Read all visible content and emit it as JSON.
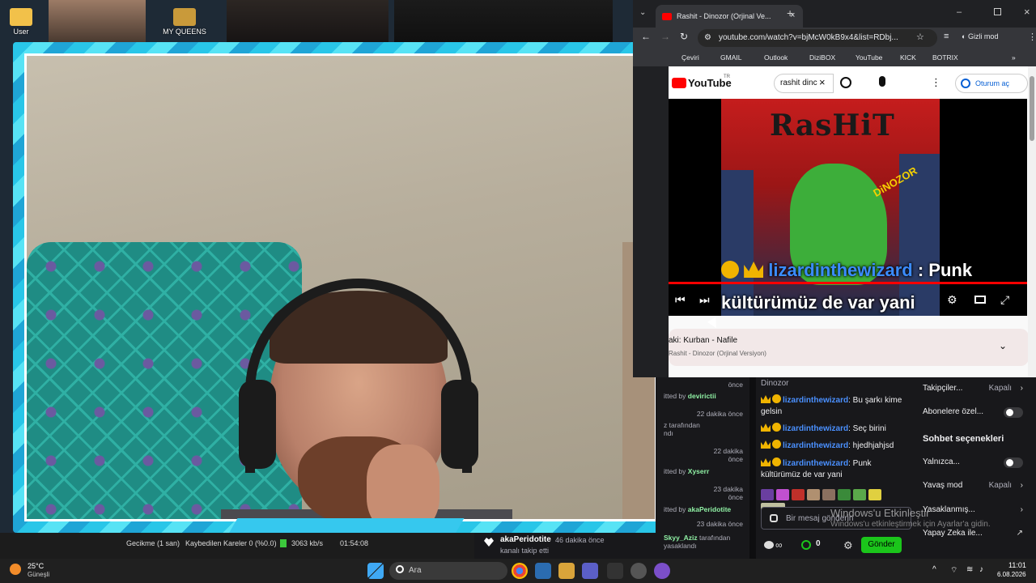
{
  "desktop": {
    "icons": [
      {
        "label": "User",
        "icon": "folder-icon"
      },
      {
        "label": "MY QUEENS",
        "icon": "folder-icon"
      }
    ]
  },
  "obs": {
    "delay": "Gecikme (1 san)",
    "dropped": "Kaybedilen Kareler 0 (%0.0)",
    "bitrate": "3063 kb/s",
    "time": "01:54:08"
  },
  "chrome": {
    "tab_title": "Rashit - Dinozor (Orjinal Ve...",
    "url": "youtube.com/watch?v=bjMcW0kB9x4&list=RDbj...",
    "incognito_label": "Gizli mod",
    "bookmarks": [
      "Çeviri",
      "GMAIL",
      "Outlook",
      "DiziBOX",
      "YouTube",
      "KICK",
      "BOTRIX"
    ],
    "window_controls": [
      "minimize-icon",
      "maximize-icon",
      "close-icon"
    ]
  },
  "youtube": {
    "logo": "YouTube",
    "region": "TR",
    "search_value": "rashit dinc",
    "signin_label": "Oturum aç",
    "album_title": "RasHiT",
    "album_subtitle": "DiNOZOR",
    "overlay": {
      "user": "lizardinthewizard",
      "text_line1": ": Punk",
      "text_line2": "kültürümüz de var yani"
    },
    "next_song_label": "aki: Kurban - Nafile",
    "next_song_sub": "Rashit - Dinozor (Orjinal Versiyon)"
  },
  "twitch": {
    "activity": [
      {
        "time": "önce",
        "text": "itted by",
        "user": "devirictii"
      },
      {
        "time": "22 dakika önce",
        "text": "z tarafından",
        "text2": "ndı"
      },
      {
        "time": "22 dakika önce",
        "text": "itted by",
        "user": "Xyserr"
      },
      {
        "time": "23 dakika önce",
        "text": "itted by",
        "user": "akaPeridotite"
      },
      {
        "time": "23 dakika önce",
        "user": "Skyy_Aziz",
        "text": "tarafından",
        "text2": "yasaklandı"
      }
    ],
    "follow_event": {
      "user": "akaPeridotite",
      "time": "46 dakika önce",
      "text": "kanalı takip etti"
    },
    "chat_header": "Dinozor",
    "messages": [
      {
        "user": "lizardinthewizard",
        "text": ": Bu şarkı kime gelsin"
      },
      {
        "user": "lizardinthewizard",
        "text": ": Seç birini"
      },
      {
        "user": "lizardinthewizard",
        "text": ": hjedhjahjsd"
      },
      {
        "user": "lizardinthewizard",
        "text": ": Punk kültürümüz de var yani"
      }
    ],
    "input_placeholder": "Bir mesaj gönderin",
    "points": "0",
    "send_label": "Gönder",
    "settings": {
      "followers_label": "Takipçiler...",
      "followers_value": "Kapalı",
      "subs_label": "Abonelere özel...",
      "section_title": "Sohbet seçenekleri",
      "only_label": "Yalnızca...",
      "slow_label": "Yavaş mod",
      "slow_value": "Kapalı",
      "banned_label": "Yasaklanmış...",
      "ai_label": "Yapay Zeka ile..."
    }
  },
  "watermark": {
    "title": "Windows'u Etkinleştir",
    "subtitle": "Windows'u etkinleştirmek için Ayarlar'a gidin."
  },
  "taskbar": {
    "weather_temp": "25°C",
    "weather_desc": "Güneşli",
    "search_placeholder": "Ara",
    "time": "11:01",
    "date": "6.08.2026"
  }
}
